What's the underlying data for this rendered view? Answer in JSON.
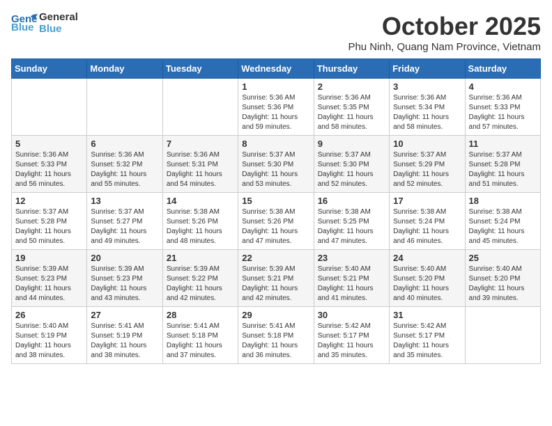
{
  "header": {
    "logo_general": "General",
    "logo_blue": "Blue",
    "month": "October 2025",
    "location": "Phu Ninh, Quang Nam Province, Vietnam"
  },
  "days_of_week": [
    "Sunday",
    "Monday",
    "Tuesday",
    "Wednesday",
    "Thursday",
    "Friday",
    "Saturday"
  ],
  "weeks": [
    [
      {
        "day": "",
        "info": ""
      },
      {
        "day": "",
        "info": ""
      },
      {
        "day": "",
        "info": ""
      },
      {
        "day": "1",
        "info": "Sunrise: 5:36 AM\nSunset: 5:36 PM\nDaylight: 11 hours\nand 59 minutes."
      },
      {
        "day": "2",
        "info": "Sunrise: 5:36 AM\nSunset: 5:35 PM\nDaylight: 11 hours\nand 58 minutes."
      },
      {
        "day": "3",
        "info": "Sunrise: 5:36 AM\nSunset: 5:34 PM\nDaylight: 11 hours\nand 58 minutes."
      },
      {
        "day": "4",
        "info": "Sunrise: 5:36 AM\nSunset: 5:33 PM\nDaylight: 11 hours\nand 57 minutes."
      }
    ],
    [
      {
        "day": "5",
        "info": "Sunrise: 5:36 AM\nSunset: 5:33 PM\nDaylight: 11 hours\nand 56 minutes."
      },
      {
        "day": "6",
        "info": "Sunrise: 5:36 AM\nSunset: 5:32 PM\nDaylight: 11 hours\nand 55 minutes."
      },
      {
        "day": "7",
        "info": "Sunrise: 5:36 AM\nSunset: 5:31 PM\nDaylight: 11 hours\nand 54 minutes."
      },
      {
        "day": "8",
        "info": "Sunrise: 5:37 AM\nSunset: 5:30 PM\nDaylight: 11 hours\nand 53 minutes."
      },
      {
        "day": "9",
        "info": "Sunrise: 5:37 AM\nSunset: 5:30 PM\nDaylight: 11 hours\nand 52 minutes."
      },
      {
        "day": "10",
        "info": "Sunrise: 5:37 AM\nSunset: 5:29 PM\nDaylight: 11 hours\nand 52 minutes."
      },
      {
        "day": "11",
        "info": "Sunrise: 5:37 AM\nSunset: 5:28 PM\nDaylight: 11 hours\nand 51 minutes."
      }
    ],
    [
      {
        "day": "12",
        "info": "Sunrise: 5:37 AM\nSunset: 5:28 PM\nDaylight: 11 hours\nand 50 minutes."
      },
      {
        "day": "13",
        "info": "Sunrise: 5:37 AM\nSunset: 5:27 PM\nDaylight: 11 hours\nand 49 minutes."
      },
      {
        "day": "14",
        "info": "Sunrise: 5:38 AM\nSunset: 5:26 PM\nDaylight: 11 hours\nand 48 minutes."
      },
      {
        "day": "15",
        "info": "Sunrise: 5:38 AM\nSunset: 5:26 PM\nDaylight: 11 hours\nand 47 minutes."
      },
      {
        "day": "16",
        "info": "Sunrise: 5:38 AM\nSunset: 5:25 PM\nDaylight: 11 hours\nand 47 minutes."
      },
      {
        "day": "17",
        "info": "Sunrise: 5:38 AM\nSunset: 5:24 PM\nDaylight: 11 hours\nand 46 minutes."
      },
      {
        "day": "18",
        "info": "Sunrise: 5:38 AM\nSunset: 5:24 PM\nDaylight: 11 hours\nand 45 minutes."
      }
    ],
    [
      {
        "day": "19",
        "info": "Sunrise: 5:39 AM\nSunset: 5:23 PM\nDaylight: 11 hours\nand 44 minutes."
      },
      {
        "day": "20",
        "info": "Sunrise: 5:39 AM\nSunset: 5:23 PM\nDaylight: 11 hours\nand 43 minutes."
      },
      {
        "day": "21",
        "info": "Sunrise: 5:39 AM\nSunset: 5:22 PM\nDaylight: 11 hours\nand 42 minutes."
      },
      {
        "day": "22",
        "info": "Sunrise: 5:39 AM\nSunset: 5:21 PM\nDaylight: 11 hours\nand 42 minutes."
      },
      {
        "day": "23",
        "info": "Sunrise: 5:40 AM\nSunset: 5:21 PM\nDaylight: 11 hours\nand 41 minutes."
      },
      {
        "day": "24",
        "info": "Sunrise: 5:40 AM\nSunset: 5:20 PM\nDaylight: 11 hours\nand 40 minutes."
      },
      {
        "day": "25",
        "info": "Sunrise: 5:40 AM\nSunset: 5:20 PM\nDaylight: 11 hours\nand 39 minutes."
      }
    ],
    [
      {
        "day": "26",
        "info": "Sunrise: 5:40 AM\nSunset: 5:19 PM\nDaylight: 11 hours\nand 38 minutes."
      },
      {
        "day": "27",
        "info": "Sunrise: 5:41 AM\nSunset: 5:19 PM\nDaylight: 11 hours\nand 38 minutes."
      },
      {
        "day": "28",
        "info": "Sunrise: 5:41 AM\nSunset: 5:18 PM\nDaylight: 11 hours\nand 37 minutes."
      },
      {
        "day": "29",
        "info": "Sunrise: 5:41 AM\nSunset: 5:18 PM\nDaylight: 11 hours\nand 36 minutes."
      },
      {
        "day": "30",
        "info": "Sunrise: 5:42 AM\nSunset: 5:17 PM\nDaylight: 11 hours\nand 35 minutes."
      },
      {
        "day": "31",
        "info": "Sunrise: 5:42 AM\nSunset: 5:17 PM\nDaylight: 11 hours\nand 35 minutes."
      },
      {
        "day": "",
        "info": ""
      }
    ]
  ]
}
